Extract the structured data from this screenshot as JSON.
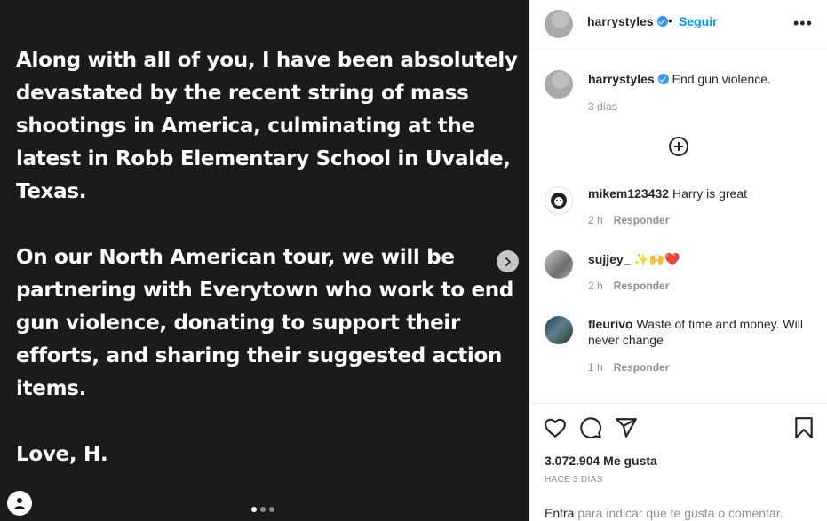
{
  "post": {
    "paragraphs": [
      "Along with all of you, I have been absolutely devastated by the recent string of mass shootings in America, culminating at the latest in Robb Elementary School in Uvalde, Texas.",
      "On our North American tour, we will be partnering with Everytown who work to end gun violence, donating to support their efforts, and sharing their suggested action items.",
      "Love, H."
    ],
    "carousel_dots": 3,
    "active_dot": 0
  },
  "header": {
    "username": "harrystyles",
    "bullet": "•",
    "follow_label": "Seguir",
    "more_label": "•••"
  },
  "caption": {
    "username": "harrystyles",
    "text": "End gun violence.",
    "time": "3 días"
  },
  "comments": [
    {
      "username": "mikem123432",
      "text": "Harry is great",
      "time": "2 h",
      "reply_label": "Responder"
    },
    {
      "username": "sujjey_",
      "text": "✨🙌❤️",
      "time": "2 h",
      "reply_label": "Responder"
    },
    {
      "username": "fleurivo",
      "text": "Waste of time and money. Will never change",
      "time": "1 h",
      "reply_label": "Responder"
    }
  ],
  "stats": {
    "likes": "3.072.904 Me gusta",
    "time_ago": "HACE 3 DÍAS"
  },
  "footer": {
    "entra": "Entra",
    "rest": " para indicar que te gusta o comentar."
  },
  "colors": {
    "post_bg": "#1c1b1b",
    "accent": "#0095f6",
    "verified": "#3897f0",
    "muted": "#8e8e8e"
  }
}
